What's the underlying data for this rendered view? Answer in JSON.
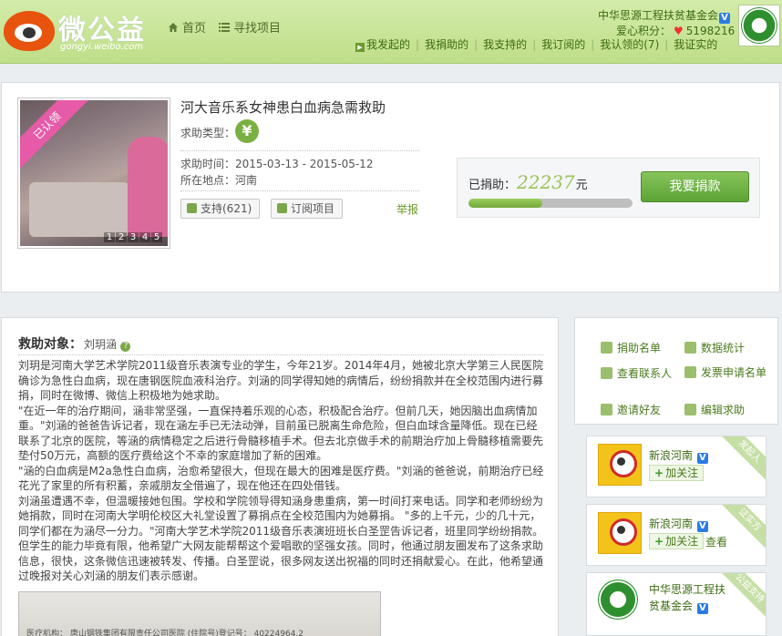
{
  "header": {
    "logo_text": "微公益",
    "logo_sub": "gongyi.weibo.com",
    "nav": [
      {
        "label": "首页",
        "icon": "home-icon"
      },
      {
        "label": "寻找项目",
        "icon": "list-icon"
      }
    ],
    "org_name": "中华思源工程扶贫基金会",
    "points_label": "爱心积分：",
    "points_value": "5198216",
    "subnav": [
      "我发起的",
      "我捐助的",
      "我支持的",
      "我订阅的",
      "我认领的(7)",
      "我证实的"
    ]
  },
  "project": {
    "title": "河大音乐系女神患白血病急需救助",
    "type_label": "求助类型：",
    "type_icon": "¥",
    "time_label": "求助时间",
    "time_value": "：2015-03-13 - 2015-05-12",
    "loc_label": "所在地点",
    "loc_value": "：河南",
    "support_btn": "支持(621)",
    "subscribe_btn": "订阅项目",
    "report": "举报",
    "claimed_ribbon": "已认领",
    "photo_pages": [
      "1",
      "2",
      "3",
      "4",
      "5"
    ],
    "donated_label": "已捐助：",
    "donated_amount": "22237",
    "donated_unit": "元",
    "donate_button": "我要捐款",
    "progress_fraction": 0.45
  },
  "rescue": {
    "heading": "救助对象：",
    "name": "刘玥涵",
    "help_icon": "?",
    "paragraphs": [
      "刘玥是河南大学艺术学院2011级音乐表演专业的学生，今年21岁。2014年4月，她被北京大学第三人民医院确诊为急性白血病，现在唐钢医院血液科治疗。刘涵的同学得知她的病情后，纷纷捐款并在全校范围内进行募捐，同时在微博、微信上积极地为她求助。",
      "\"在近一年的治疗期间，涵非常坚强，一直保持着乐观的心态，积极配合治疗。但前几天，她因脑出血病情加重。\"刘涵的爸爸告诉记者，现在涵左手已无法动弹，目前虽已脱离生命危险，但白血球含量降低。现在已经联系了北京的医院，等涵的病情稳定之后进行骨髓移植手术。但去北京做手术的前期治疗加上骨髓移植需要先垫付50万元，高额的医疗费给这个不幸的家庭增加了新的困难。",
      "\"涵的白血病是M2a急性白血病，治愈希望很大，但现在最大的困难是医疗费。\"刘涵的爸爸说，前期治疗已经花光了家里的所有积蓄，亲戚朋友全借遍了，现在他还在四处借钱。",
      "刘涵虽遭遇不幸，但温暖接她包围。学校和学院领导得知涵身患重病，第一时间打来电话。同学和老师纷纷为她捐款，同时在河南大学明伦校区大礼堂设置了募捐点在全校范围内为她募捐。        \"多的上千元，少的几十元，同学们都在为涵尽一分力。\"河南大学艺术学院2011级音乐表演班班长白圣罡告诉记者，班里同学纷纷捐款。但学生的能力毕竟有限，他希望广大网友能帮帮这个爱唱歌的坚强女孩。同时，他通过朋友圈发布了这条求助信息，很快，这条微信迅速被转发、传播。白圣罡说，很多网友送出祝福的同时还捐献爱心。在此，他希望通过晚报对关心刘涵的朋友们表示感谢。"
    ],
    "doc_line": "医疗机构：        唐山钢铁集团有限责任公司医院                (住院号)登记号：  40224964.2"
  },
  "sidebar": {
    "links": [
      {
        "label": "捐助名单",
        "icon": "people-icon"
      },
      {
        "label": "数据统计",
        "icon": "stats-icon"
      },
      {
        "label": "查看联系人",
        "icon": "contact-icon"
      },
      {
        "label": "发票申请名单",
        "icon": "invoice-icon"
      },
      {
        "label": "邀请好友",
        "icon": "invite-icon"
      },
      {
        "label": "编辑求助",
        "icon": "edit-icon"
      }
    ],
    "cards": [
      {
        "name": "新浪河南",
        "follow": "加关注",
        "corner": "发起人"
      },
      {
        "name": "新浪河南",
        "follow": "加关注",
        "look": "查看",
        "corner": "证实方"
      },
      {
        "name": "中华思源工程扶贫基金会",
        "corner": "公益支持"
      }
    ]
  }
}
